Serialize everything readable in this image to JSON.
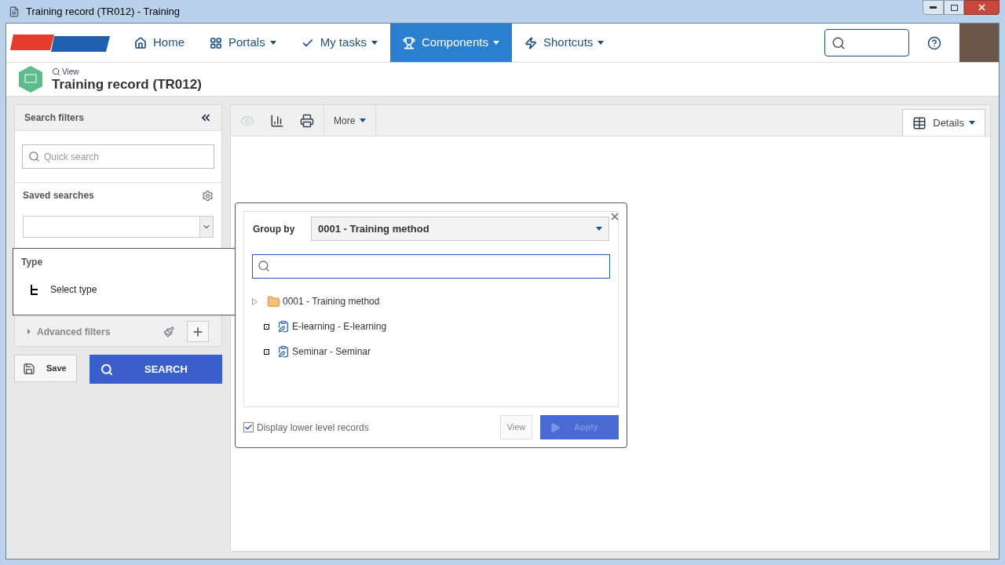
{
  "window": {
    "title": "Training record (TR012) - Training"
  },
  "nav": {
    "items": [
      {
        "label": "Home",
        "dropdown": false,
        "selected": false
      },
      {
        "label": "Portals",
        "dropdown": true,
        "selected": false
      },
      {
        "label": "My tasks",
        "dropdown": true,
        "selected": false
      },
      {
        "label": "Components",
        "dropdown": true,
        "selected": true
      },
      {
        "label": "Shortcuts",
        "dropdown": true,
        "selected": false
      }
    ]
  },
  "header": {
    "action": "View",
    "title": "Training record (TR012)"
  },
  "sidebar": {
    "title": "Search filters",
    "quick_search": {
      "placeholder": "Quick search"
    },
    "saved_searches": "Saved searches",
    "type_label": "Type",
    "select_type": "Select type",
    "advanced_filters": "Advanced filters",
    "save": "Save",
    "search": "SEARCH"
  },
  "toolbar": {
    "more": "More",
    "details": "Details"
  },
  "popup": {
    "group_by_label": "Group by",
    "group_by_value": "0001 - Training method",
    "tree": [
      {
        "label": "0001 - Training method",
        "expanded": false,
        "kind": "folder"
      },
      {
        "label": "E-learning - E-learning",
        "kind": "record"
      },
      {
        "label": "Seminar - Seminar",
        "kind": "record"
      }
    ],
    "display_lower": {
      "label": "Display lower level records",
      "checked": true
    },
    "view": {
      "label": "View",
      "disabled": true
    },
    "apply": {
      "label": "Apply",
      "disabled": true
    }
  }
}
